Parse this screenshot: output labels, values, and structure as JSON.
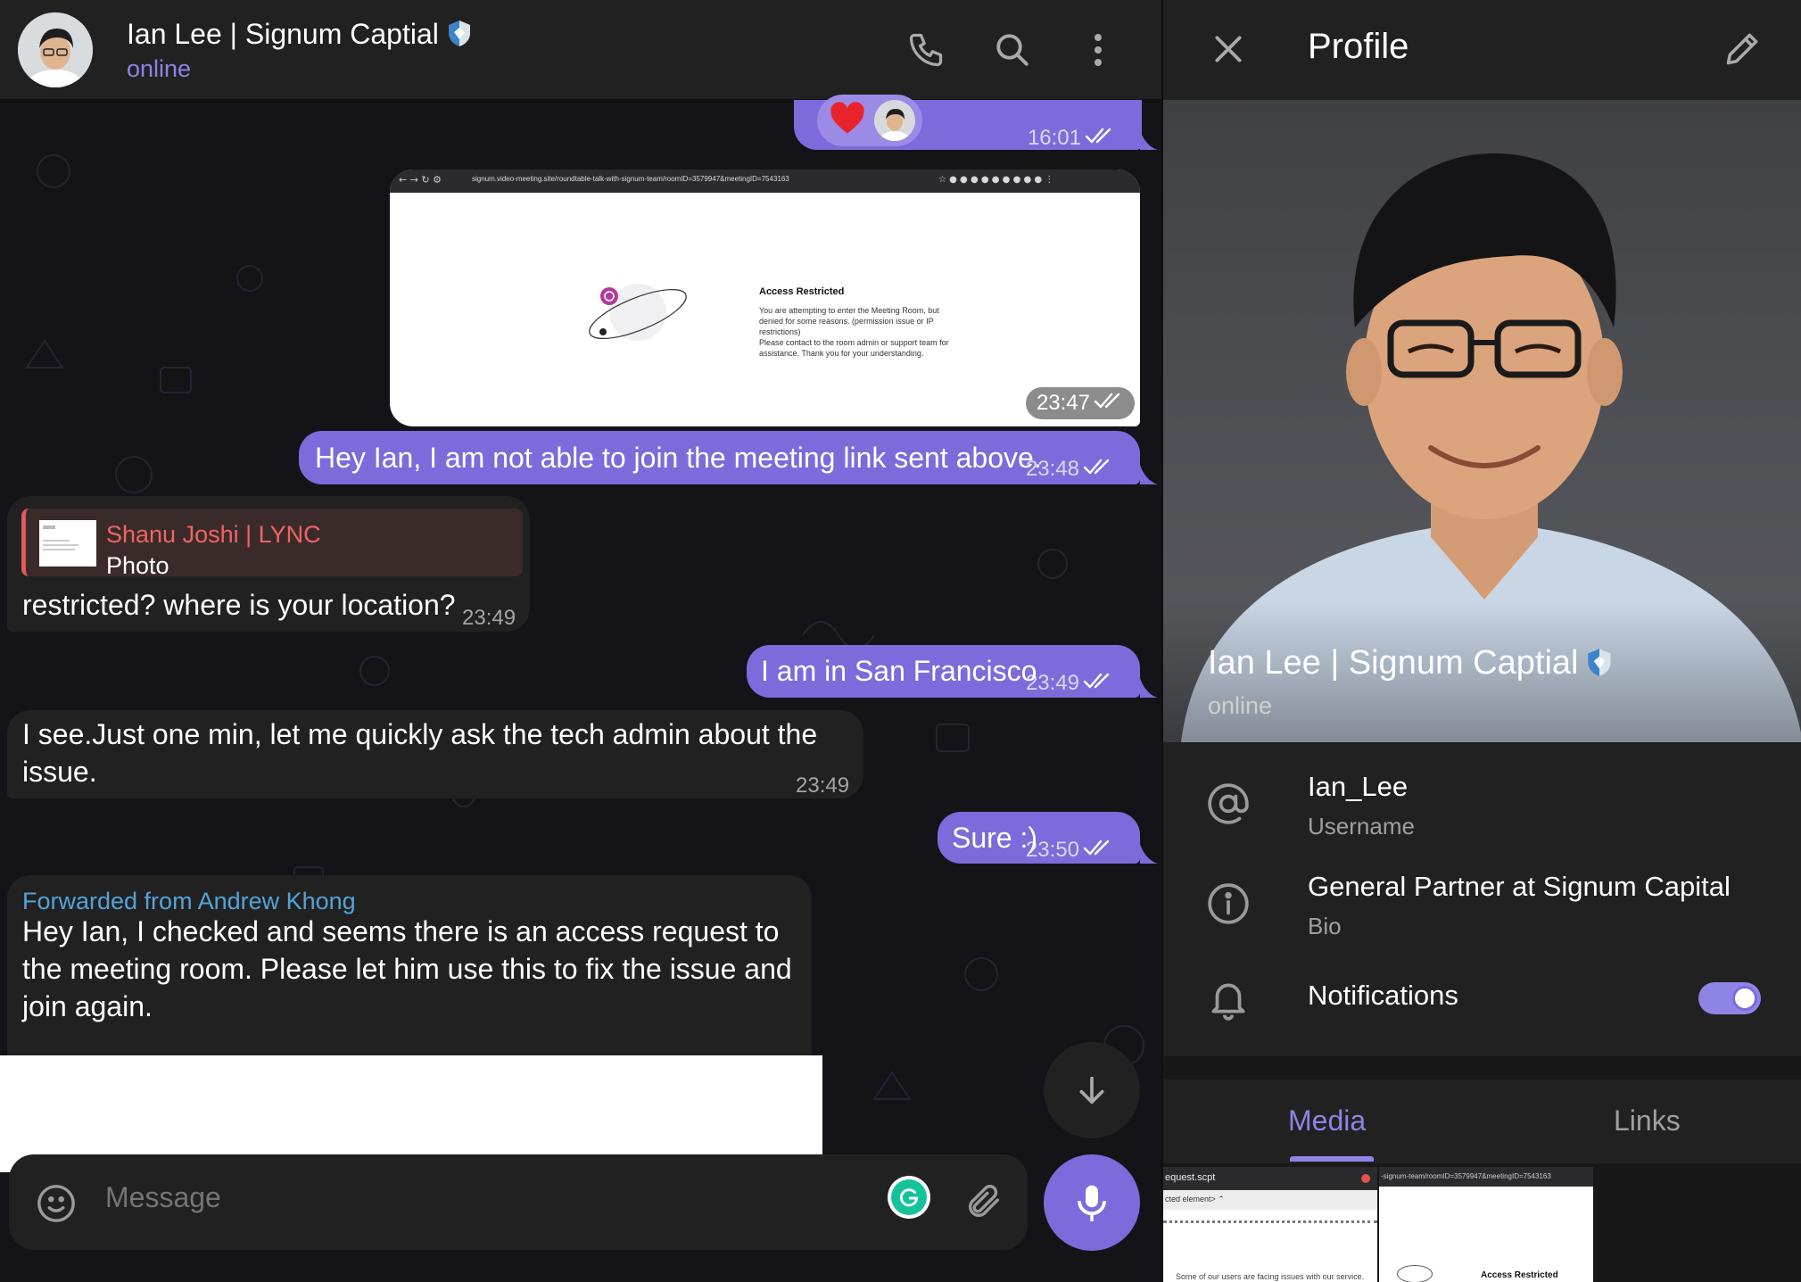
{
  "chat": {
    "header": {
      "title": "Ian Lee | Signum Captial",
      "status": "online"
    },
    "messages": {
      "m1_time": "16:01",
      "m2_time": "23:47",
      "m2_image": {
        "url": "signum.video-meeting.site/roundtable-talk-with-signum-team/roomID=3579947&meetingID=7543163",
        "heading": "Access Restricted",
        "line1": "You are attempting to enter the Meeting Room, but",
        "line2": "denied for some reasons. (permission issue or IP",
        "line3": "restrictions)",
        "line4": "Please contact to the room admin or support team for",
        "line5": "assistance. Thank you for your understanding."
      },
      "m3_text": "Hey Ian, I am not able to join the meeting link sent above.",
      "m3_time": "23:48",
      "m4_reply_name": "Shanu Joshi | LYNC",
      "m4_reply_sub": "Photo",
      "m4_text": "restricted? where is your location?",
      "m4_time": "23:49",
      "m5_text": "I am in San Francisco",
      "m5_time": "23:49",
      "m6_text_line1": "I see.Just one min, let me quickly ask the tech admin about the",
      "m6_text_line2": "issue.",
      "m6_time": "23:49",
      "m7_text": "Sure :)",
      "m7_time": "23:50",
      "m8_forward": "Forwarded from Andrew Khong",
      "m8_line1": "Hey Ian, I checked and seems there is an access request to",
      "m8_line2": "the meeting room. Please let him use this to fix the issue and",
      "m8_line3": "join again."
    },
    "composer": {
      "placeholder": "Message"
    }
  },
  "profile": {
    "title": "Profile",
    "name": "Ian Lee | Signum Captial",
    "status": "online",
    "username": "Ian_Lee",
    "username_label": "Username",
    "bio": "General Partner at Signum Capital",
    "bio_label": "Bio",
    "notifications_label": "Notifications",
    "notifications_on": true,
    "tabs": [
      "Media",
      "Links"
    ],
    "media": {
      "thumb1_title": "equest.scpt",
      "thumb1_line": "cted element> ⌃",
      "thumb1_footer": "Some of our users are facing issues with our service.",
      "thumb2_url": "-signum-team/roomID=3579947&meetingID=7543163",
      "thumb2_heading": "Access Restricted"
    }
  },
  "colors": {
    "accent": "#8d84e6",
    "outgoing_bubble": "#7e6bdb",
    "incoming_bubble": "#212121",
    "forward_label": "#53a4d8",
    "reply_name": "#f06464"
  }
}
